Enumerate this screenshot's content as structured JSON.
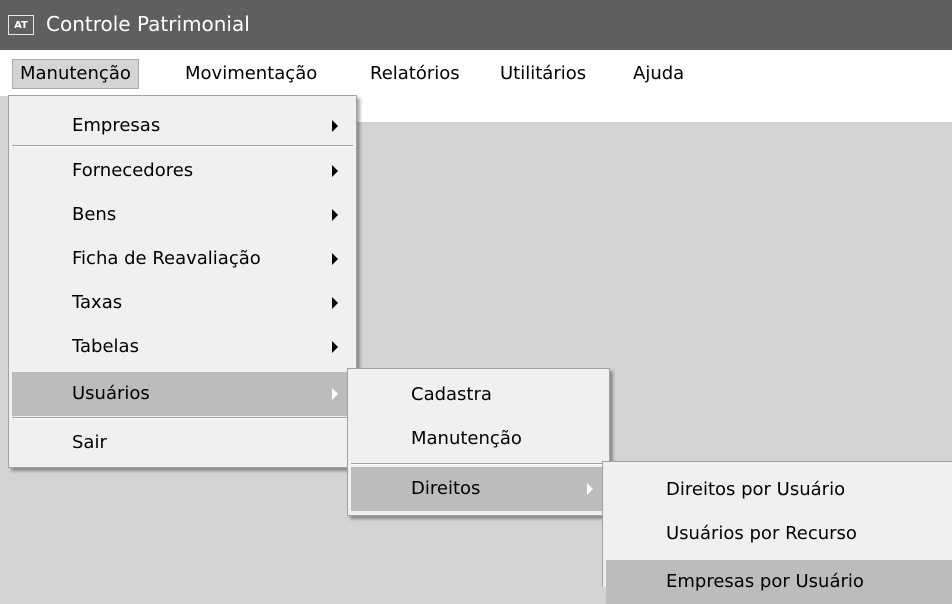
{
  "window": {
    "title": "Controle Patrimonial",
    "icon_text": "AT"
  },
  "menubar": {
    "items": [
      "Manutenção",
      "Movimentação",
      "Relatórios",
      "Utilitários",
      "Ajuda"
    ]
  },
  "menu_manutencao": {
    "items": [
      "Empresas",
      "Fornecedores",
      "Bens",
      "Ficha de Reavaliação",
      "Taxas",
      "Tabelas",
      "Usuários",
      "Sair"
    ]
  },
  "submenu_usuarios": {
    "items": [
      "Cadastra",
      "Manutenção",
      "Direitos"
    ]
  },
  "submenu_direitos": {
    "items": [
      "Direitos por Usuário",
      "Usuários por Recurso",
      "Empresas por Usuário"
    ]
  }
}
